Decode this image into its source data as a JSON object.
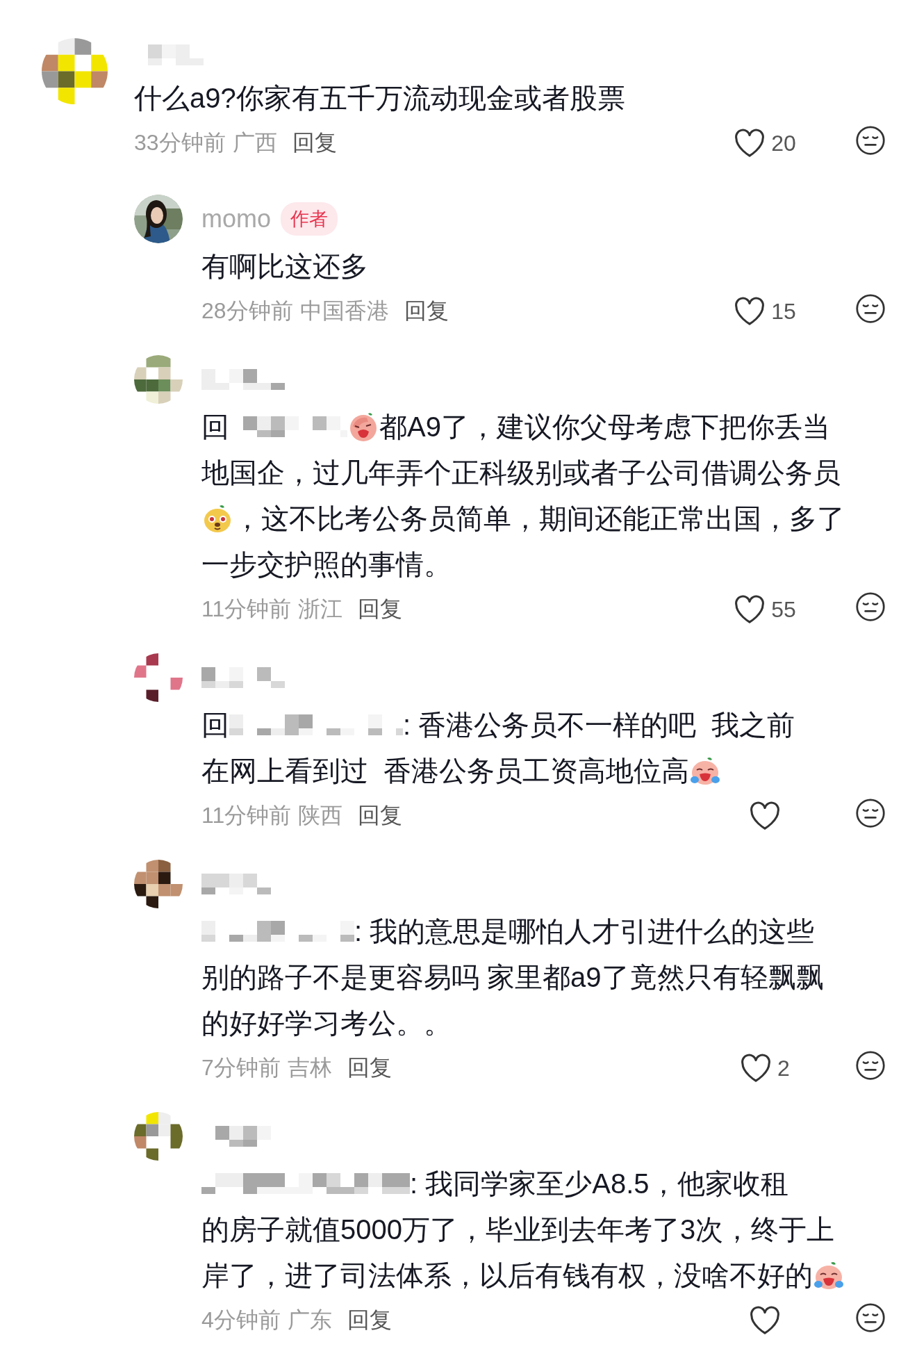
{
  "comments": [
    {
      "author": {
        "kind": "redacted"
      },
      "avatar": {
        "kind": "mosaic"
      },
      "lines": [
        [
          {
            "kind": "text",
            "text": "什么a9?你家有五千万流动现金或者股票"
          }
        ]
      ],
      "time": "33分钟前",
      "location": "广西",
      "reply_label": "回复",
      "likes": "20",
      "replies": [
        {
          "author": {
            "kind": "named",
            "name": "momo",
            "badge": "作者"
          },
          "avatar": {
            "kind": "picture"
          },
          "lines": [
            [
              {
                "kind": "text",
                "text": "有啊比这还多"
              }
            ]
          ],
          "time": "28分钟前",
          "location": "中国香港",
          "reply_label": "回复",
          "likes": "15"
        },
        {
          "author": {
            "kind": "redacted"
          },
          "avatar": {
            "kind": "mosaic"
          },
          "lines": [
            [
              {
                "kind": "text",
                "text": "回"
              },
              {
                "kind": "redacted"
              },
              {
                "kind": "facepalm"
              },
              {
                "kind": "text",
                "text": "都A9了，建议你父母考虑下把你丢当"
              }
            ],
            [
              {
                "kind": "text",
                "text": "地国企，过几年弄个正科级别或者子公司借调公务员"
              }
            ],
            [
              {
                "kind": "puppy"
              },
              {
                "kind": "text",
                "text": "，这不比考公务员简单，期间还能正常出国，多了"
              }
            ],
            [
              {
                "kind": "text",
                "text": "一步交护照的事情。"
              }
            ]
          ],
          "time": "11分钟前",
          "location": "浙江",
          "reply_label": "回复",
          "likes": "55"
        },
        {
          "author": {
            "kind": "redacted"
          },
          "avatar": {
            "kind": "mosaic"
          },
          "lines": [
            [
              {
                "kind": "text",
                "text": "回"
              },
              {
                "kind": "redacted"
              },
              {
                "kind": "text",
                "text": ": 香港公务员不一样的吧  我之前"
              }
            ],
            [
              {
                "kind": "text",
                "text": "在网上看到过  香港公务员工资高地位高"
              },
              {
                "kind": "crying"
              }
            ]
          ],
          "time": "11分钟前",
          "location": "陕西",
          "reply_label": "回复"
        },
        {
          "author": {
            "kind": "redacted"
          },
          "avatar": {
            "kind": "mosaic"
          },
          "lines": [
            [
              {
                "kind": "redacted"
              },
              {
                "kind": "text",
                "text": ": 我的意思是哪怕人才引进什么的这些"
              }
            ],
            [
              {
                "kind": "text",
                "text": "别的路子不是更容易吗 家里都a9了竟然只有轻飘飘"
              }
            ],
            [
              {
                "kind": "text",
                "text": "的好好学习考公。。"
              }
            ]
          ],
          "time": "7分钟前",
          "location": "吉林",
          "reply_label": "回复",
          "likes": "2"
        },
        {
          "author": {
            "kind": "redacted"
          },
          "avatar": {
            "kind": "mosaic"
          },
          "lines": [
            [
              {
                "kind": "redacted"
              },
              {
                "kind": "text",
                "text": ": 我同学家至少A8.5，他家收租"
              }
            ],
            [
              {
                "kind": "text",
                "text": "的房子就值5000万了，毕业到去年考了3次，终于上"
              }
            ],
            [
              {
                "kind": "text",
                "text": "岸了，进了司法体系，以后有钱有权，没啥不好的"
              },
              {
                "kind": "crying"
              }
            ]
          ],
          "time": "4分钟前",
          "location": "广东",
          "reply_label": "回复"
        }
      ]
    }
  ]
}
